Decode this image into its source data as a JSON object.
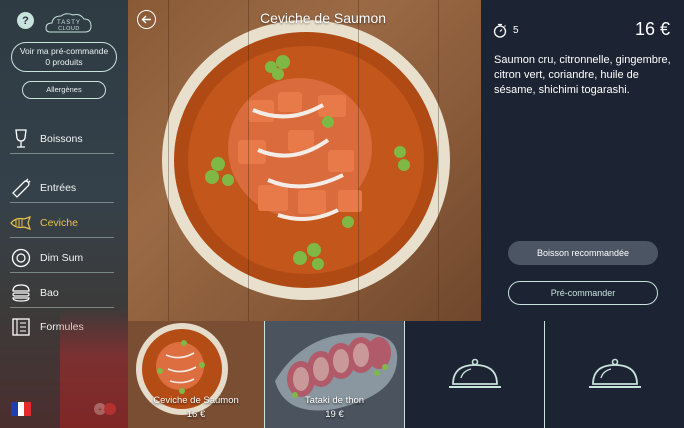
{
  "sidebar": {
    "help_label": "?",
    "logo_text": "TASTY CLOUD",
    "preorder": {
      "title": "Voir ma pré-commande",
      "count": "0 produits"
    },
    "allergens_label": "Allergènes",
    "nav": [
      {
        "label": "Boissons",
        "icon": "glass-icon",
        "active": false
      },
      {
        "label": "Entrées",
        "icon": "carrot-icon",
        "active": false
      },
      {
        "label": "Ceviche",
        "icon": "fish-icon",
        "active": true
      },
      {
        "label": "Dim Sum",
        "icon": "dimsum-icon",
        "active": false
      },
      {
        "label": "Bao",
        "icon": "bao-icon",
        "active": false
      },
      {
        "label": "Formules",
        "icon": "menu-book-icon",
        "active": false
      }
    ],
    "active_color": "#e8c24a"
  },
  "dish": {
    "title": "Ceviche de Saumon",
    "prep_time": "5",
    "price": "16 €",
    "description": "Saumon cru, citronnelle, gingembre, citron vert, coriandre, huile de sésame, shichimi togarashi."
  },
  "actions": {
    "recommend_label": "Boisson recommandée",
    "preorder_label": "Pré-commander"
  },
  "thumbnails": [
    {
      "name": "Ceviche de Saumon",
      "price": "16 €"
    },
    {
      "name": "Tataki de thon",
      "price": "19 €"
    }
  ],
  "colors": {
    "panel": "#1c2433",
    "mint": "#c8e2dc",
    "accent": "#e8c24a"
  }
}
